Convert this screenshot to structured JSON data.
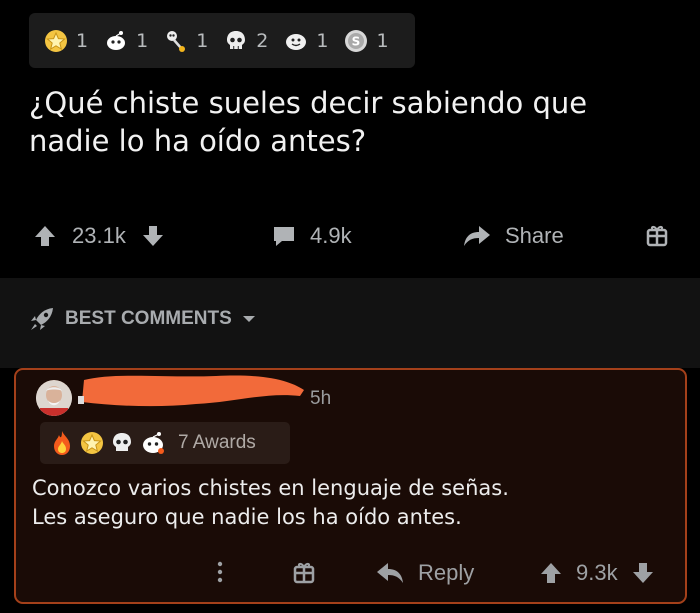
{
  "post": {
    "awards": [
      {
        "icon": "gold-star-award-icon",
        "count": "1"
      },
      {
        "icon": "snoo-wholesome-award-icon",
        "count": "1"
      },
      {
        "icon": "skeleton-flower-award-icon",
        "count": "1"
      },
      {
        "icon": "skull-award-icon",
        "count": "2"
      },
      {
        "icon": "face-award-icon",
        "count": "1"
      },
      {
        "icon": "silver-coin-award-icon",
        "count": "1"
      }
    ],
    "title": "¿Qué chiste sueles decir sabiendo que nadie lo ha oído antes?",
    "upvotes": "23.1k",
    "comments": "4.9k",
    "share_label": "Share"
  },
  "sort": {
    "label": "BEST COMMENTS"
  },
  "comment": {
    "time": "5h",
    "awards_label": "7 Awards",
    "body_line1": "Conozco varios chistes en lenguaje de señas.",
    "body_line2": "Les aseguro que nadie los ha oído antes.",
    "reply_label": "Reply",
    "score": "9.3k"
  },
  "colors": {
    "accent_border": "#a4401a",
    "comment_bg": "#1a0b06",
    "redaction": "#f26a3a"
  }
}
